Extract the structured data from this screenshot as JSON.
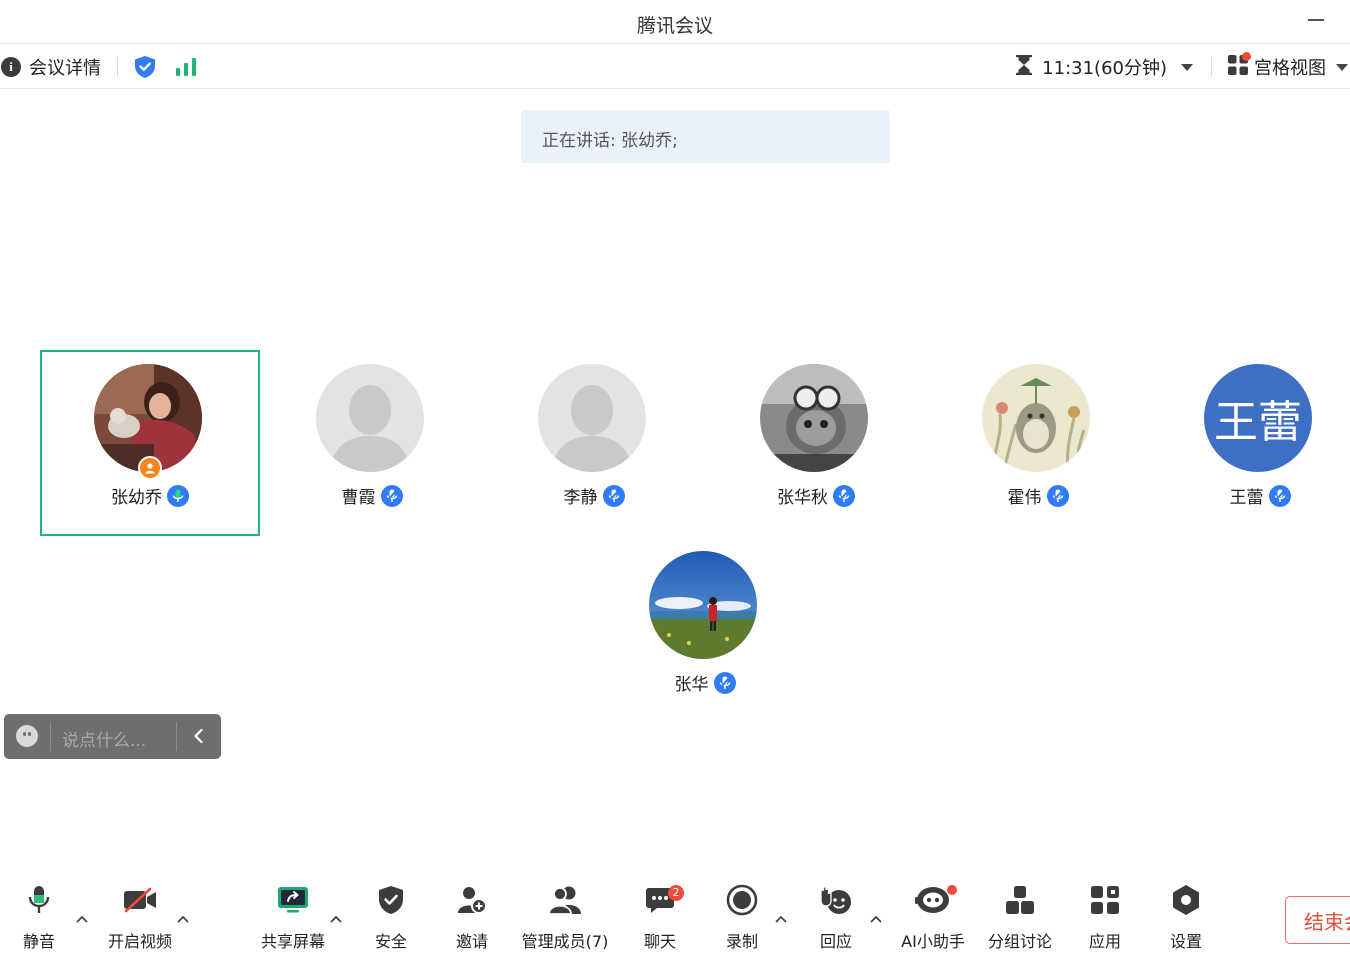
{
  "window": {
    "title": "腾讯会议"
  },
  "infobar": {
    "details_label": "会议详情",
    "timer": "11:31(60分钟)",
    "view_label": "宫格视图"
  },
  "speaking": {
    "text": "正在讲话: 张幼乔;"
  },
  "participants": [
    {
      "name": "张幼乔",
      "active": true,
      "mic": "on",
      "host": true,
      "avatar": "photo-woman-cat"
    },
    {
      "name": "曹霞",
      "mic": "muted",
      "avatar": "default-silhouette"
    },
    {
      "name": "李静",
      "mic": "muted",
      "avatar": "default-silhouette"
    },
    {
      "name": "张华秋",
      "mic": "muted",
      "avatar": "photo-cat-goggles"
    },
    {
      "name": "霍伟",
      "mic": "muted",
      "avatar": "illustration-totoro"
    },
    {
      "name": "王蕾",
      "mic": "muted",
      "avatar_text": "王蕾"
    },
    {
      "name": "张华",
      "mic": "muted",
      "avatar": "photo-landscape-person"
    }
  ],
  "chat": {
    "placeholder": "说点什么..."
  },
  "toolbar": {
    "mute": "静音",
    "video": "开启视频",
    "share": "共享屏幕",
    "security": "安全",
    "invite": "邀请",
    "members": "管理成员(7)",
    "chat": "聊天",
    "chat_badge": "2",
    "record": "录制",
    "react": "回应",
    "ai": "AI小助手",
    "breakout": "分组讨论",
    "apps": "应用",
    "settings": "设置",
    "end": "结束会议"
  },
  "colors": {
    "accent": "#2f7cf6",
    "active_border": "#22b573",
    "share_green": "#19a971",
    "danger": "#f04b3a"
  }
}
